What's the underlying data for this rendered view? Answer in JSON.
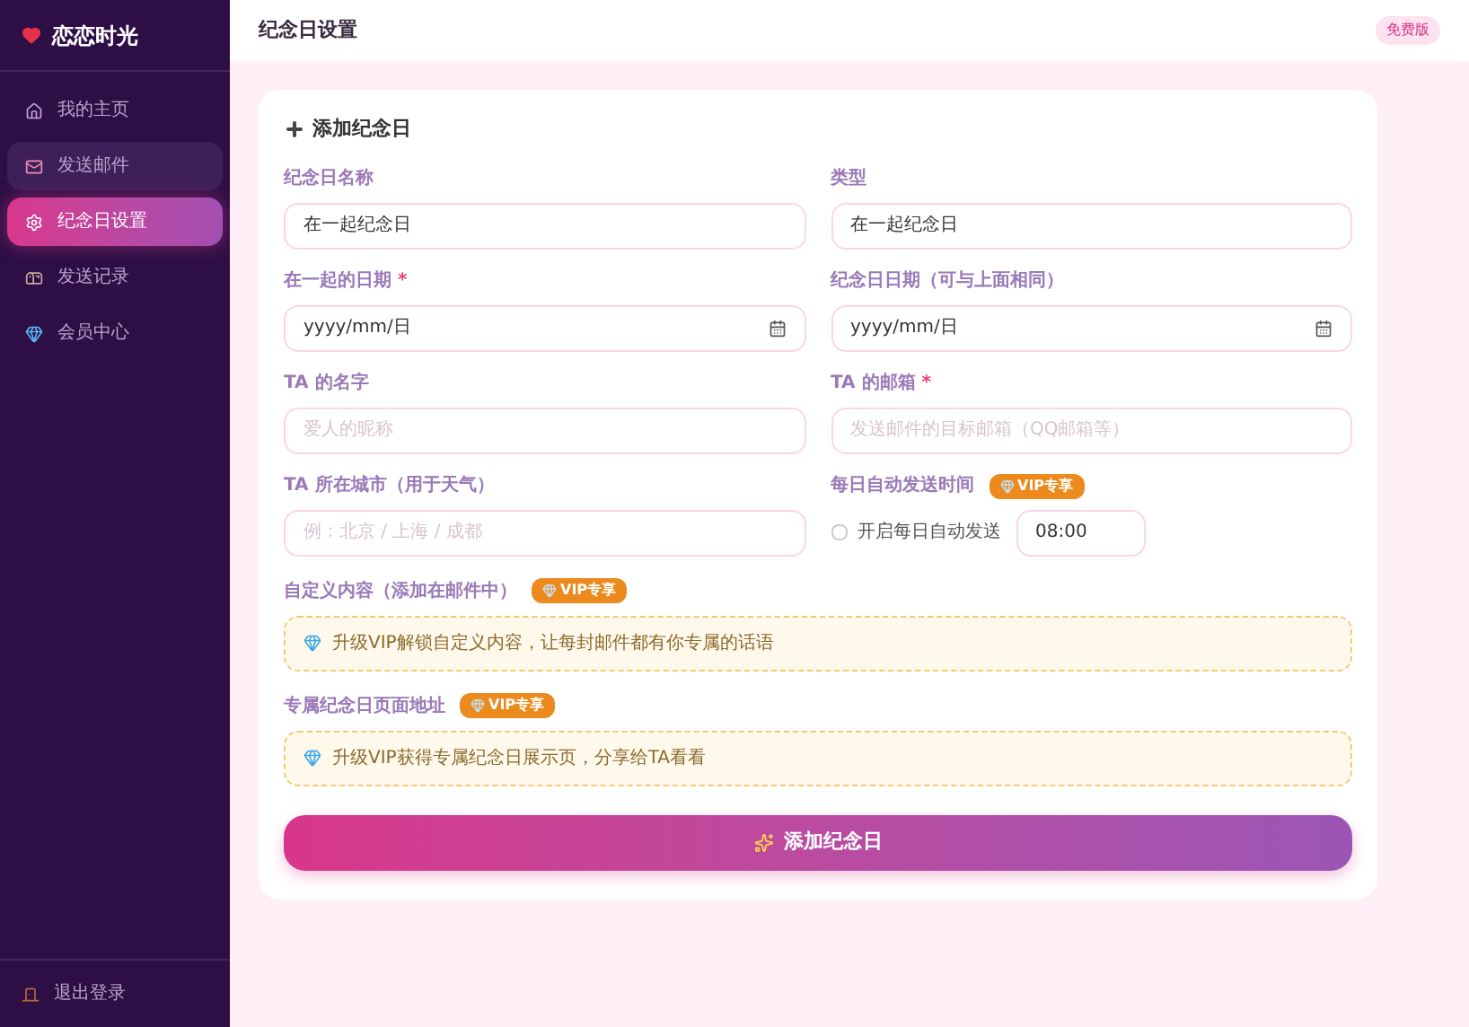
{
  "sidebar": {
    "logo": "恋恋时光",
    "items": [
      {
        "label": "我的主页",
        "selected": false,
        "hovered": false
      },
      {
        "label": "发送邮件",
        "selected": false,
        "hovered": true
      },
      {
        "label": "纪念日设置",
        "selected": true,
        "hovered": false
      },
      {
        "label": "发送记录",
        "selected": false,
        "hovered": false
      },
      {
        "label": "会员中心",
        "selected": false,
        "hovered": false
      }
    ],
    "logout": "退出登录"
  },
  "header": {
    "title": "纪念日设置",
    "badge": "免费版"
  },
  "form": {
    "title": "添加纪念日",
    "fields": [
      {
        "kind": "text",
        "label": "纪念日名称",
        "value": "在一起纪念日"
      },
      {
        "kind": "text",
        "label": "类型",
        "value": "在一起纪念日"
      },
      {
        "kind": "date",
        "label": "在一起的日期",
        "required_mark": "*",
        "value": "yyyy/mm/日"
      },
      {
        "kind": "date",
        "label": "纪念日日期（可与上面相同）",
        "value": "yyyy/mm/日"
      },
      {
        "kind": "text",
        "label": "TA 的名字",
        "placeholder": "爱人的昵称"
      },
      {
        "kind": "text",
        "label": "TA 的邮箱",
        "required_mark": "*",
        "placeholder": "发送邮件的目标邮箱（QQ邮箱等）"
      },
      {
        "kind": "text",
        "label": "TA 所在城市（用于天气）",
        "placeholder": "例：北京 / 上海 / 成都"
      },
      {
        "kind": "time",
        "label": "每日自动发送时间",
        "badge": "VIP专享",
        "checkbox_label": "开启每日自动发送",
        "checked": false,
        "value": "08:00"
      }
    ],
    "vip_sections": [
      {
        "label": "自定义内容（添加在邮件中）",
        "badge": "VIP专享",
        "notice": "升级VIP解锁自定义内容，让每封邮件都有你专属的话语"
      },
      {
        "label": "专属纪念日页面地址",
        "badge": "VIP专享",
        "notice": "升级VIP获得专属纪念日展示页，分享给TA看看"
      }
    ],
    "submit": "添加纪念日"
  }
}
